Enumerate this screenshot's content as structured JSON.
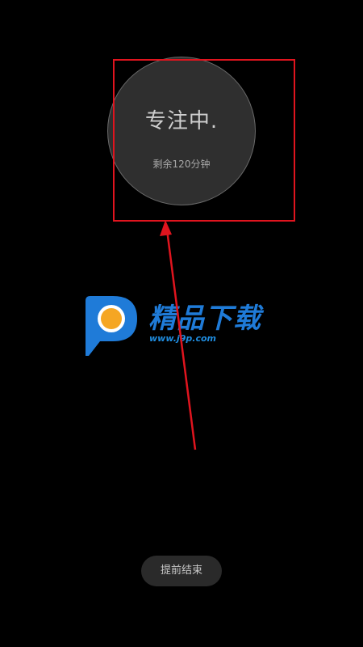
{
  "focus": {
    "status_label": "专注中.",
    "remaining_text": "剩余120分钟"
  },
  "watermark": {
    "brand_text": "精品下载",
    "url_text": "www.j9p.com"
  },
  "actions": {
    "end_early_label": "提前结束"
  },
  "colors": {
    "background": "#000000",
    "circle_fill": "#2f2f2f",
    "annotation_red": "#e0141e",
    "watermark_blue": "#1f7bd8",
    "watermark_orange": "#f5a623"
  }
}
